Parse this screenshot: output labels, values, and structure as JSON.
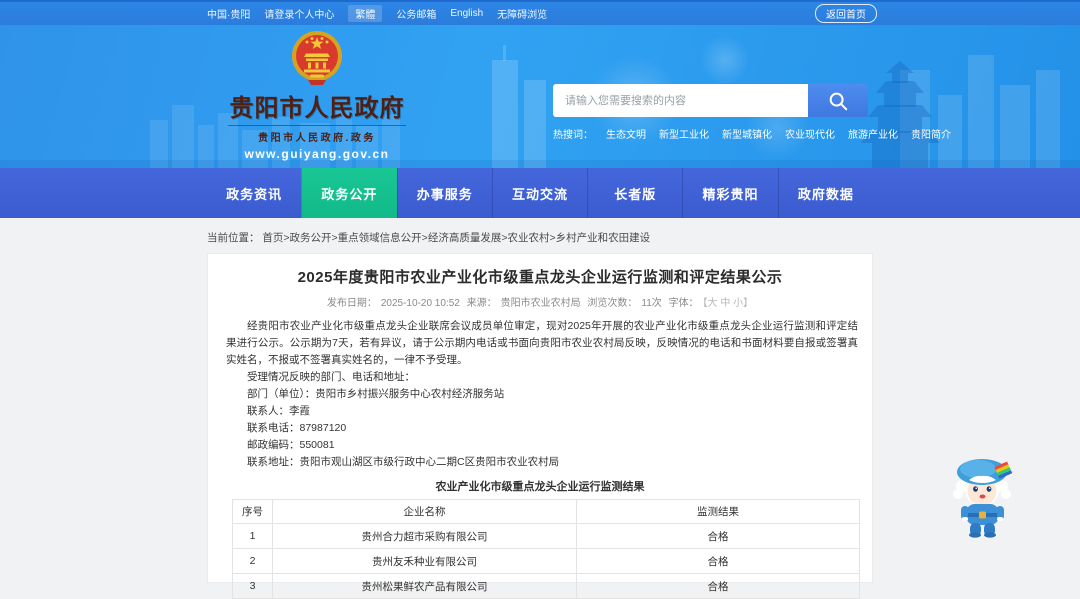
{
  "topbar": {
    "region": "中国·贵阳",
    "login": "请登录个人中心",
    "traditional": "繁體",
    "mail": "公务邮箱",
    "english": "English",
    "accessibility": "无障碍浏览",
    "back_home": "返回首页"
  },
  "header": {
    "site_name": "贵阳市人民政府",
    "site_subtitle": "贵阳市人民政府.政务",
    "site_url": "www.guiyang.gov.cn",
    "search": {
      "placeholder": "请输入您需要搜索的内容",
      "hot_label": "热搜词：",
      "hot_words": [
        "生态文明",
        "新型工业化",
        "新型城镇化",
        "农业现代化",
        "旅游产业化",
        "贵阳简介"
      ]
    }
  },
  "nav": {
    "items": [
      {
        "label": "政务资讯",
        "active": false
      },
      {
        "label": "政务公开",
        "active": true
      },
      {
        "label": "办事服务",
        "active": false
      },
      {
        "label": "互动交流",
        "active": false
      },
      {
        "label": "长者版",
        "active": false
      },
      {
        "label": "精彩贵阳",
        "active": false
      },
      {
        "label": "政府数据",
        "active": false
      }
    ]
  },
  "breadcrumb": {
    "label": "当前位置：",
    "path": "首页>政务公开>重点领域信息公开>经济高质量发展>农业农村>乡村产业和农田建设"
  },
  "article": {
    "title": "2025年度贵阳市农业产业化市级重点龙头企业运行监测和评定结果公示",
    "meta": {
      "publish_label": "发布日期：",
      "publish_date": "2025-10-20 10:52",
      "source_label": "来源：",
      "source": "贵阳市农业农村局",
      "views_label": "浏览次数：",
      "views": "11次",
      "font_label": "字体：",
      "font_sizes": "【大 中 小】"
    },
    "paragraphs": [
      "经贵阳市农业产业化市级重点龙头企业联席会议成员单位审定，现对2025年开展的农业产业化市级重点龙头企业运行监测和评定结果进行公示。公示期为7天，若有异议，请于公示期内电话或书面向贵阳市农业农村局反映，反映情况的电话和书面材料要自报或签署真实姓名，不报或不签署真实姓名的，一律不予受理。",
      "受理情况反映的部门、电话和地址：",
      "部门（单位）：贵阳市乡村振兴服务中心农村经济服务站",
      "联系人：李霞",
      "联系电话：87987120",
      "邮政编码：550081",
      "联系地址：贵阳市观山湖区市级行政中心二期C区贵阳市农业农村局"
    ],
    "table": {
      "caption": "农业产业化市级重点龙头企业运行监测结果",
      "headers": [
        "序号",
        "企业名称",
        "监测结果"
      ],
      "rows": [
        [
          "1",
          "贵州合力超市采购有限公司",
          "合格"
        ],
        [
          "2",
          "贵州友禾种业有限公司",
          "合格"
        ],
        [
          "3",
          "贵州松果鲜农产品有限公司",
          "合格"
        ]
      ]
    }
  },
  "colors": {
    "topbar_blue": "#2d86e6",
    "banner_blue": "#31a2f2",
    "nav_blue": "#3e63d8",
    "active_green": "#15c294",
    "brand_maroon": "#4d2016",
    "search_button_blue": "#4484ec",
    "page_bg": "#f1f2f4"
  }
}
